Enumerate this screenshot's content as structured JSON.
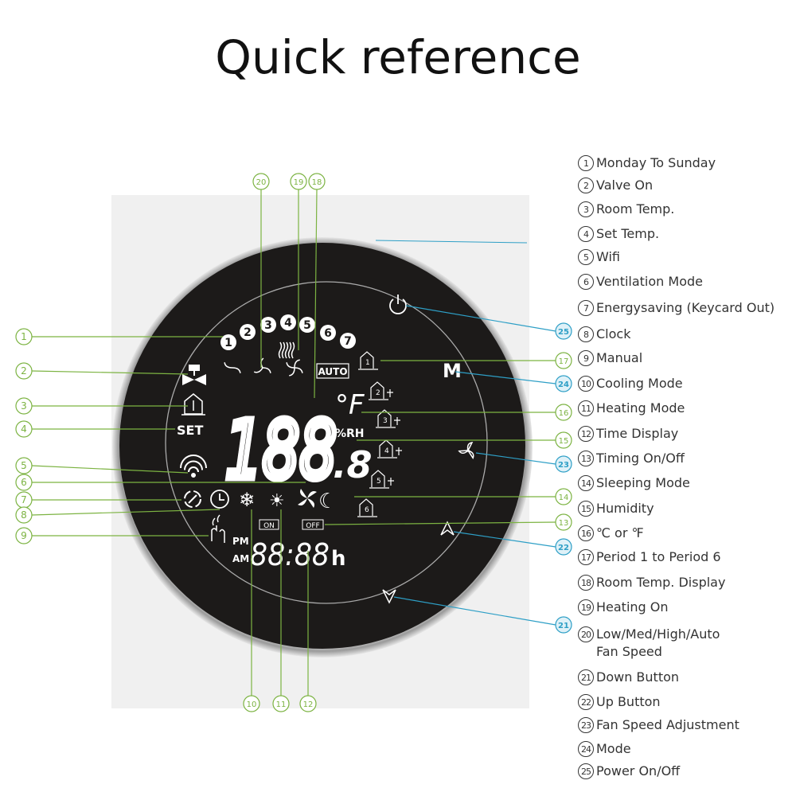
{
  "title": "Quick reference",
  "colors": {
    "callout_green": "#7cb342",
    "callout_blue": "#2e9fc6",
    "display_bg": "#1c1a19",
    "ring": "#c8c8c8",
    "panel_bg": "#efefef"
  },
  "legend": [
    {
      "num": "1",
      "label": "Monday To Sunday"
    },
    {
      "num": "2",
      "label": "Valve On"
    },
    {
      "num": "3",
      "label": "Room Temp."
    },
    {
      "num": "4",
      "label": "Set Temp."
    },
    {
      "num": "5",
      "label": "Wifi"
    },
    {
      "num": "6",
      "label": "Ventilation Mode"
    },
    {
      "num": "7",
      "label": "Energysaving (Keycard Out)"
    },
    {
      "num": "8",
      "label": "Clock"
    },
    {
      "num": "9",
      "label": "Manual"
    },
    {
      "num": "10",
      "label": "Cooling Mode"
    },
    {
      "num": "11",
      "label": "Heating Mode"
    },
    {
      "num": "12",
      "label": "Time Display"
    },
    {
      "num": "13",
      "label": "Timing On/Off"
    },
    {
      "num": "14",
      "label": "Sleeping Mode"
    },
    {
      "num": "15",
      "label": "Humidity"
    },
    {
      "num": "16",
      "label": "℃ or ℉"
    },
    {
      "num": "17",
      "label": "Period 1 to Period 6"
    },
    {
      "num": "18",
      "label": "Room Temp. Display"
    },
    {
      "num": "19",
      "label": "Heating On"
    },
    {
      "num": "20",
      "label": "Low/Med/High/Auto",
      "label2": "Fan Speed"
    },
    {
      "num": "21",
      "label": "Down Button"
    },
    {
      "num": "22",
      "label": "Up Button"
    },
    {
      "num": "23",
      "label": "Fan Speed Adjustment"
    },
    {
      "num": "24",
      "label": "Mode"
    },
    {
      "num": "25",
      "label": "Power On/Off"
    }
  ],
  "display": {
    "days": [
      "1",
      "2",
      "3",
      "4",
      "5",
      "6",
      "7"
    ],
    "auto": "AUTO",
    "set": "SET",
    "temp": "188",
    "temp_decimal": ".8",
    "unit": "°F",
    "humidity": "%RH",
    "on": "ON",
    "off": "OFF",
    "pm": "PM",
    "am": "AM",
    "time": "88:88",
    "hour_unit": "h",
    "periods": [
      "1",
      "2",
      "3",
      "4",
      "5",
      "6"
    ],
    "mode_button": "M"
  },
  "icons": [
    "valve-icon",
    "house-thermometer-icon",
    "wifi-icon",
    "energysaving-icon",
    "clock-icon",
    "snowflake-icon",
    "sun-icon",
    "ventilation-icon",
    "moon-icon",
    "hand-icon",
    "fan-icon",
    "heating-waves-icon",
    "power-icon",
    "up-arrow-icon",
    "down-arrow-icon"
  ]
}
